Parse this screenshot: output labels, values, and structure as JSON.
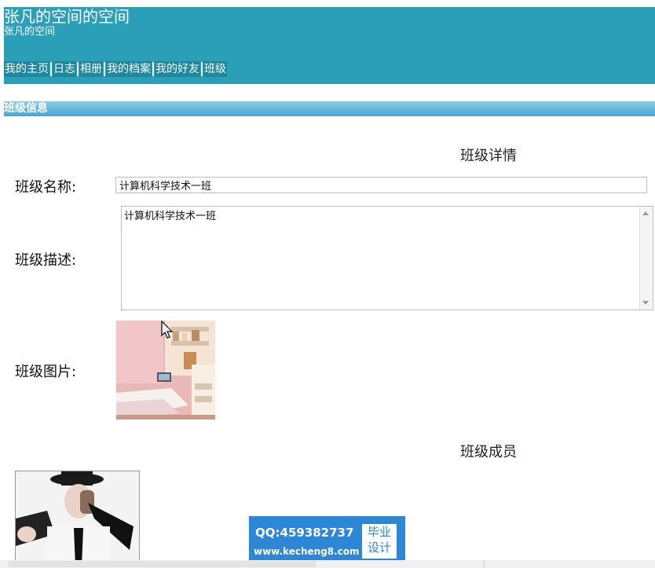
{
  "header": {
    "title": "张凡的空间的空间",
    "subtitle": "张凡的空间"
  },
  "nav": {
    "items": [
      "我的主页",
      "日志",
      "相册",
      "我的档案",
      "我的好友",
      "班级"
    ]
  },
  "section": {
    "title": "班级信息"
  },
  "detail": {
    "heading": "班级详情",
    "name_label": "班级名称:",
    "name_value": "计算机科学技术一班",
    "desc_label": "班级描述:",
    "desc_value": "计算机科学技术一班",
    "image_label": "班级图片:"
  },
  "members": {
    "heading": "班级成员"
  },
  "watermark": {
    "qq": "QQ:459382737",
    "url": "www.kecheng8.com",
    "badge_line1": "毕业",
    "badge_line2": "设计"
  },
  "colors": {
    "header_bg": "#2b9fb7",
    "section_bar": "#4aa6d2",
    "watermark_bg": "#2e86d6"
  }
}
